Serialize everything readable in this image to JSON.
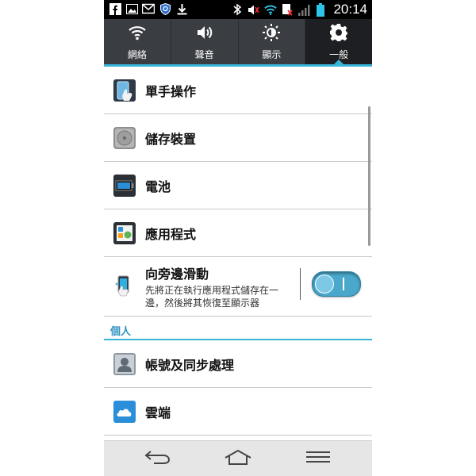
{
  "statusbar": {
    "time": "20:14",
    "left_icons": [
      "facebook-icon",
      "gallery-icon",
      "gmail-icon",
      "shield-icon",
      "download-icon"
    ],
    "right_icons": [
      "bluetooth-icon",
      "volume-icon",
      "wifi-icon",
      "sim-icon",
      "signal-icon",
      "battery-icon"
    ]
  },
  "tabs": [
    {
      "label": "網絡",
      "icon": "wifi-icon"
    },
    {
      "label": "聲音",
      "icon": "speaker-icon"
    },
    {
      "label": "顯示",
      "icon": "brightness-icon"
    },
    {
      "label": "一般",
      "icon": "gear-icon",
      "active": true
    }
  ],
  "list": {
    "one_hand": {
      "title": "單手操作"
    },
    "storage": {
      "title": "儲存裝置"
    },
    "battery": {
      "title": "電池"
    },
    "apps": {
      "title": "應用程式"
    },
    "slide_aside": {
      "title": "向旁邊滑動",
      "subtitle": "先將正在執行應用程式儲存在一邊，然後將其恢復至顯示器",
      "toggle_on": true
    },
    "section_personal": "個人",
    "accounts": {
      "title": "帳號及同步處理"
    },
    "cloud": {
      "title": "雲端"
    }
  },
  "colors": {
    "accent": "#36b5d9",
    "tabbar": "#3a3d42",
    "section_text": "#2f93c0"
  }
}
